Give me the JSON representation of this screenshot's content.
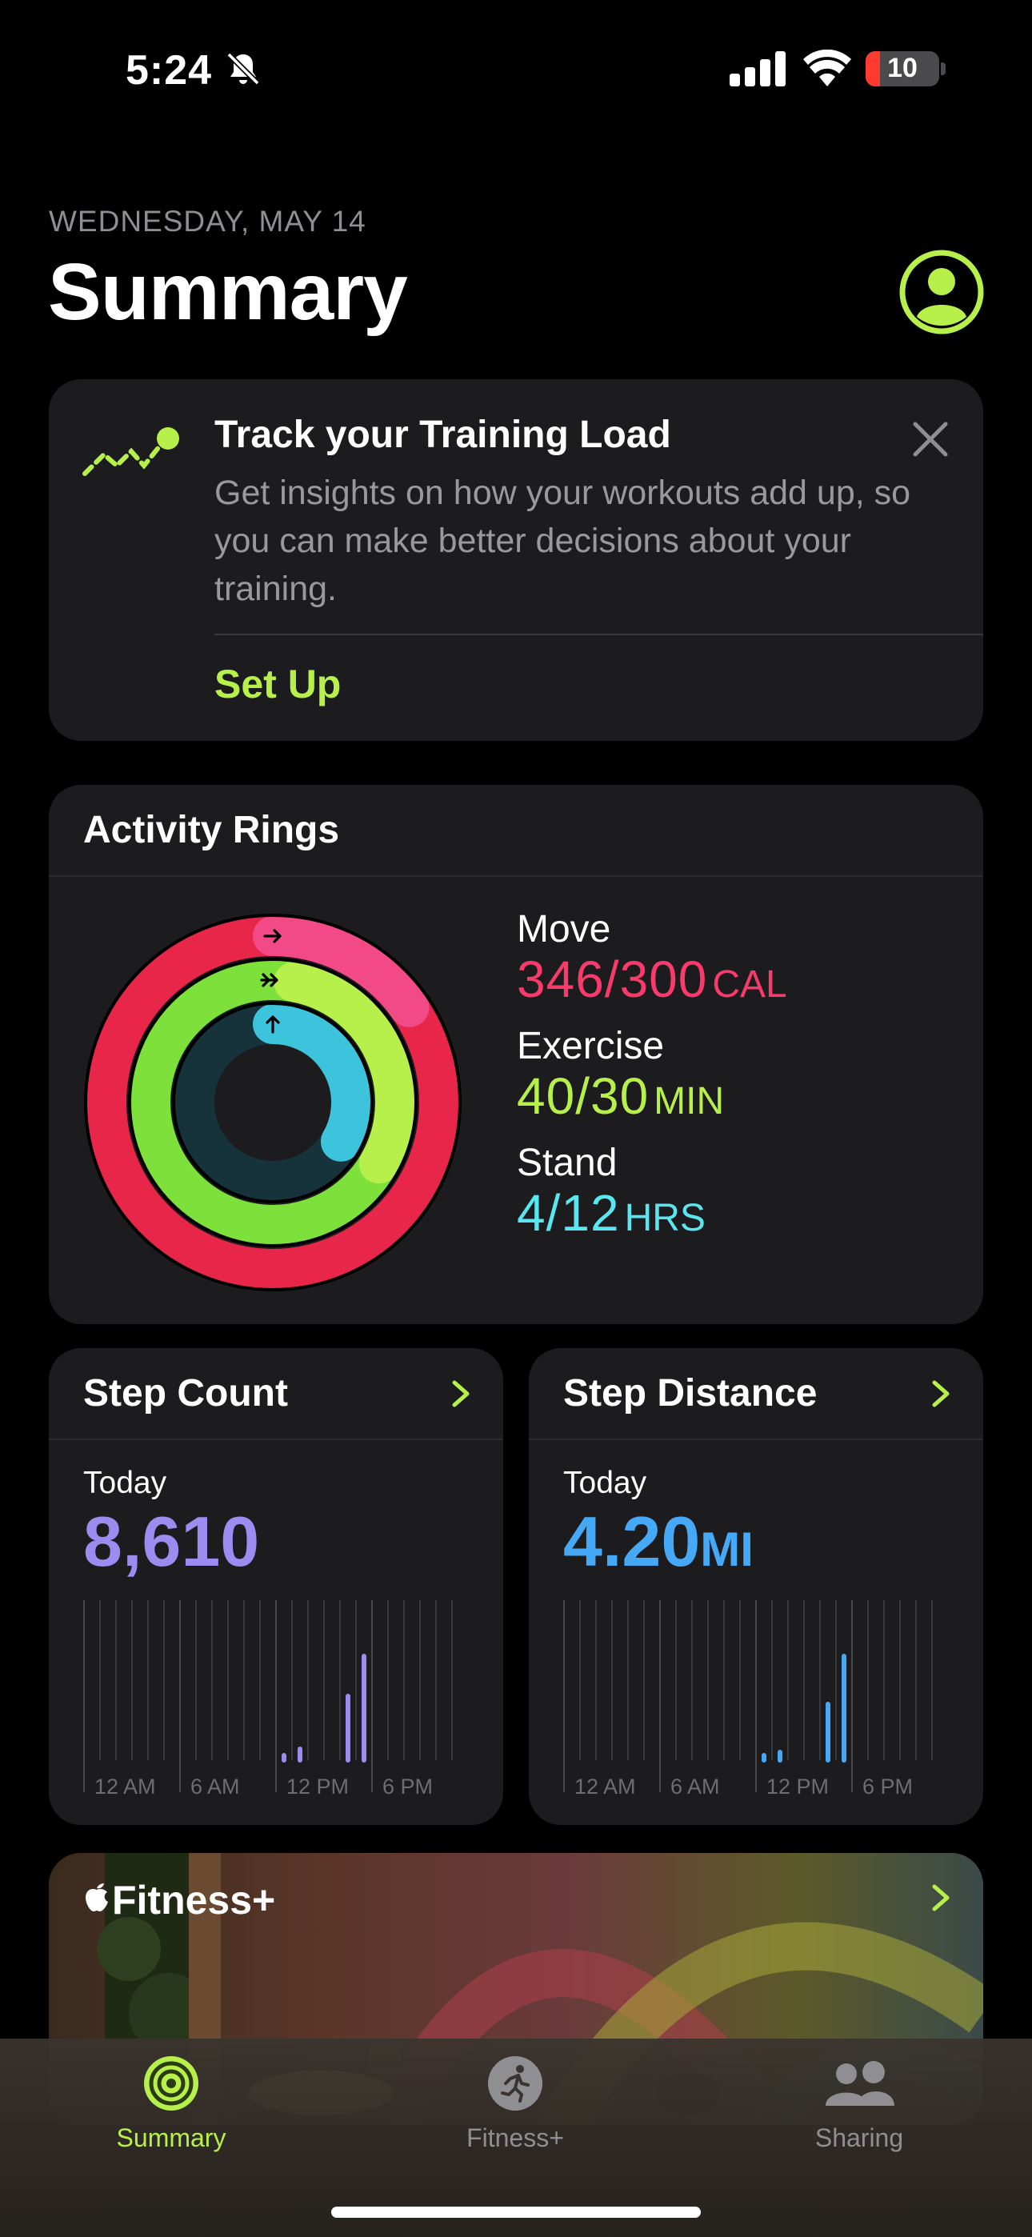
{
  "status_bar": {
    "time": "5:24",
    "battery": "10"
  },
  "header": {
    "date": "WEDNESDAY, MAY 14",
    "title": "Summary"
  },
  "training_card": {
    "title": "Track your Training Load",
    "body": "Get insights on how your workouts add up, so you can make better decisions about your training.",
    "action": "Set Up"
  },
  "activity": {
    "title": "Activity Rings",
    "move": {
      "label": "Move",
      "value": "346/300",
      "unit": "CAL",
      "fraction": 1.153
    },
    "exercise": {
      "label": "Exercise",
      "value": "40/30",
      "unit": "MIN",
      "fraction": 1.333
    },
    "stand": {
      "label": "Stand",
      "value": "4/12",
      "unit": "HRS",
      "fraction": 0.333
    }
  },
  "step_count": {
    "title": "Step Count",
    "period": "Today",
    "value": "8,610",
    "unit": "",
    "axis": [
      "12 AM",
      "6 AM",
      "12 PM",
      "6 PM"
    ],
    "hourly": [
      0,
      0,
      0,
      0,
      0,
      0,
      0,
      0,
      0,
      0,
      0,
      0,
      0.03,
      0.07,
      0,
      0,
      0.4,
      0.65,
      0,
      0,
      0,
      0,
      0,
      0
    ]
  },
  "step_distance": {
    "title": "Step Distance",
    "period": "Today",
    "value": "4.20",
    "unit": "MI",
    "axis": [
      "12 AM",
      "6 AM",
      "12 PM",
      "6 PM"
    ],
    "hourly": [
      0,
      0,
      0,
      0,
      0,
      0,
      0,
      0,
      0,
      0,
      0,
      0,
      0.03,
      0.05,
      0,
      0,
      0.35,
      0.65,
      0,
      0,
      0,
      0,
      0,
      0
    ]
  },
  "fitness_plus": {
    "title": "Fitness+"
  },
  "tabs": [
    {
      "label": "Summary",
      "active": true
    },
    {
      "label": "Fitness+",
      "active": false
    },
    {
      "label": "Sharing",
      "active": false
    }
  ],
  "colors": {
    "accent": "#b7f04a",
    "move": "#fa114f",
    "exercise": "#a6ff00",
    "stand": "#00f0ff",
    "step_count": "#9d8cf0",
    "step_distance": "#46a9f7"
  }
}
